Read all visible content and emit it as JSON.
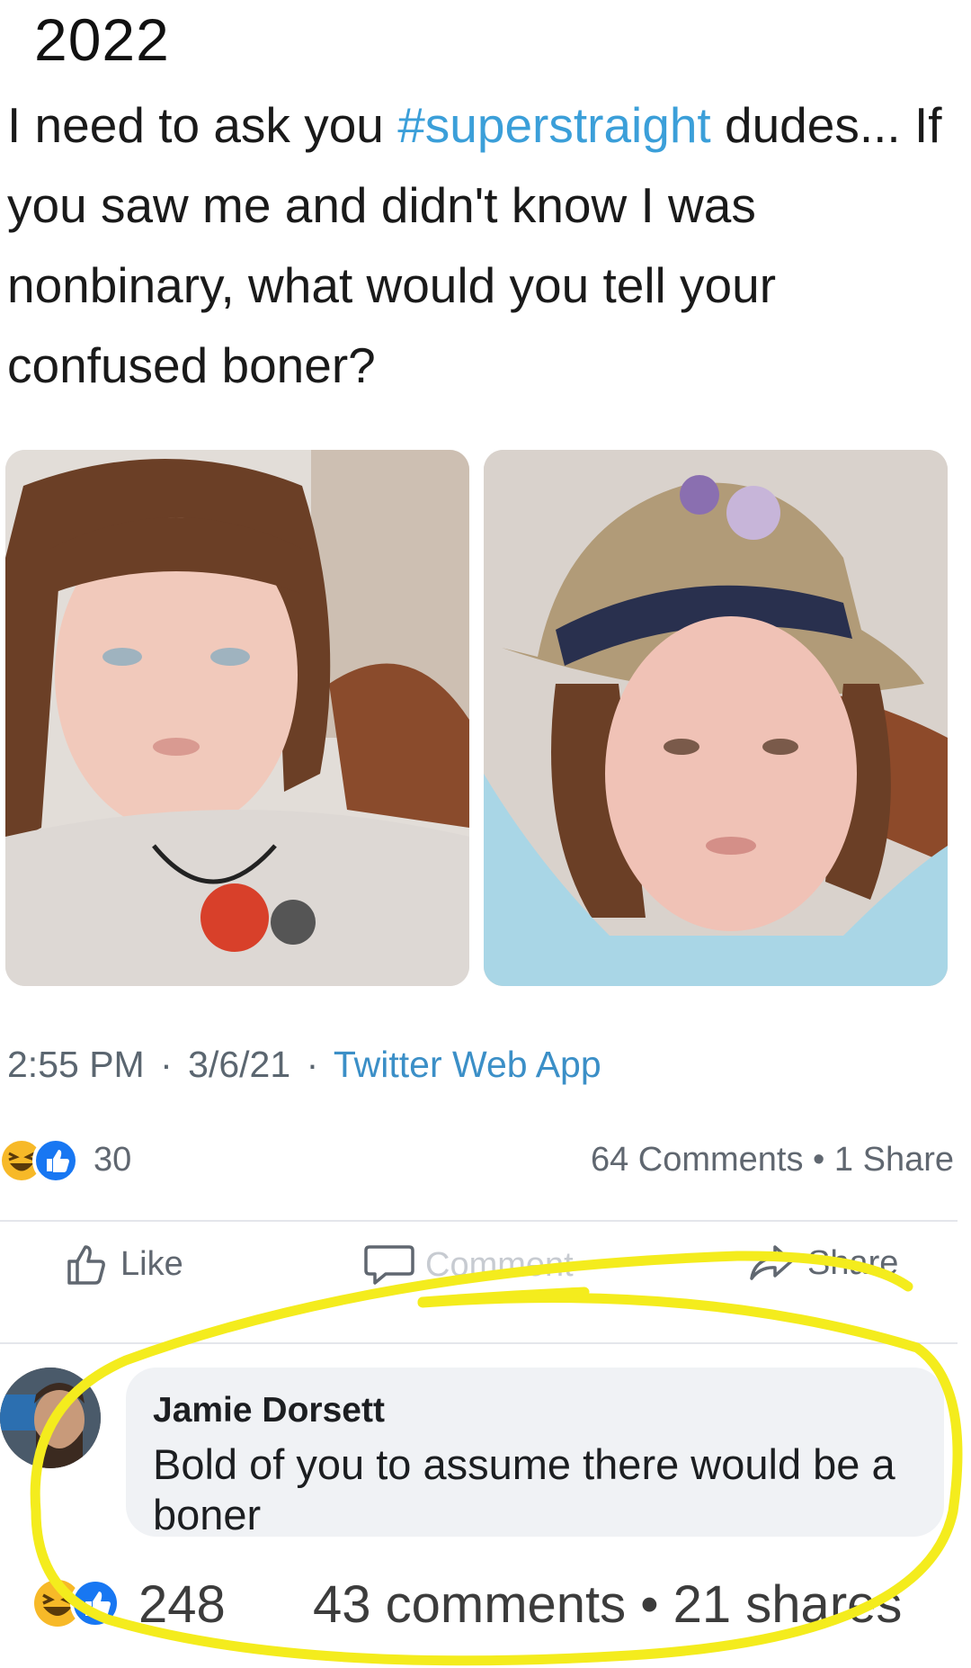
{
  "caption": {
    "year": "2022"
  },
  "tweet": {
    "text_before_hashtag": "I need to ask you ",
    "hashtag": "#superstraight",
    "text_after_hashtag": " dudes... If you saw me and didn't know I was nonbinary, what would you tell your confused boner?",
    "time": "2:55 PM",
    "date": "3/6/21",
    "source": "Twitter Web App",
    "separator": "·"
  },
  "post_stats": {
    "reactions_count": "30",
    "comments_shares": "64 Comments • 1 Share"
  },
  "actions": {
    "like_label": "Like",
    "comment_label": "Comment",
    "share_label": "Share"
  },
  "comment": {
    "author": "Jamie Dorsett",
    "text": "Bold of you to assume there would be a boner"
  },
  "bottom_stats": {
    "reactions_count": "248",
    "comments_shares": "43 comments • 21 shares"
  },
  "colors": {
    "hashtag": "#3b9fd9",
    "like_blue": "#1877f2",
    "haha_yellow": "#f7b928",
    "marker_yellow": "#f4ec1d"
  },
  "icons": [
    "haha-reaction-icon",
    "like-reaction-icon",
    "like-thumb-icon",
    "comment-bubble-icon",
    "share-arrow-icon"
  ]
}
